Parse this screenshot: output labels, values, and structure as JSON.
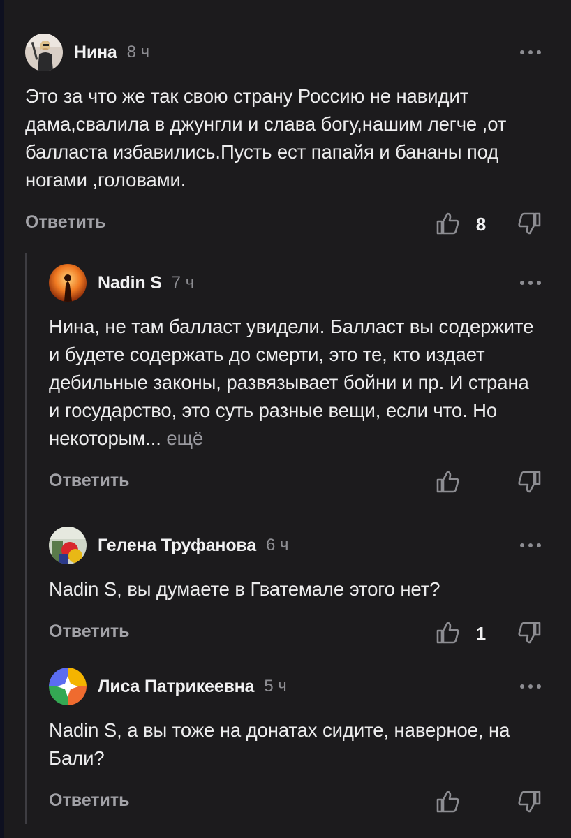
{
  "colors": {
    "background": "#1c1b1d",
    "text": "#ececed",
    "muted": "#8d8d92",
    "thread_line": "#3e3d42"
  },
  "comments": [
    {
      "author": "Нина",
      "time": "8 ч",
      "text": "Это за что же так свою страну Россию не навидит дама,свалила в джунгли и слава богу,нашим легче ,от балласта избавились.Пусть ест папайя и бананы под ногами ,головами.",
      "more_link": "",
      "reply_label": "Ответить",
      "likes": "8",
      "avatar_icon": "user-photo-avatar"
    },
    {
      "author": "Nadin S",
      "time": "7 ч",
      "text": "Нина, не там балласт увидели. Балласт вы содержите и будете содержать до смерти, это те, кто издает дебильные законы, развязывает бойни и пр. И страна и государство, это суть разные вещи, если что. Но некоторым...",
      "more_link": "ещё",
      "reply_label": "Ответить",
      "likes": "",
      "avatar_icon": "user-photo-avatar"
    },
    {
      "author": "Гелена Труфанова",
      "time": "6 ч",
      "text": "Nadin S, вы думаете в Гватемале этого нет?",
      "more_link": "",
      "reply_label": "Ответить",
      "likes": "1",
      "avatar_icon": "user-photo-avatar"
    },
    {
      "author": "Лиса Патрикеевна",
      "time": "5 ч",
      "text": "Nadin S, а вы тоже на донатах сидите, наверное, на Бали?",
      "more_link": "",
      "reply_label": "Ответить",
      "likes": "",
      "avatar_icon": "default-star-avatar"
    }
  ]
}
